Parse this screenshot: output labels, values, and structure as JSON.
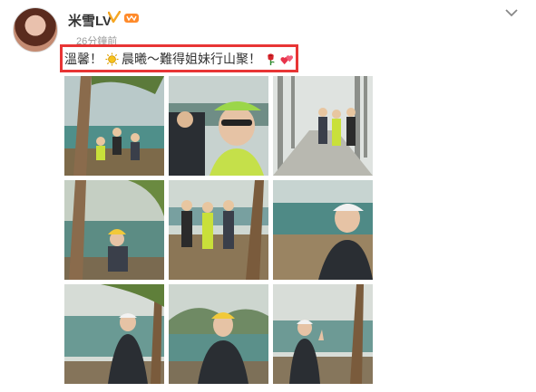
{
  "post": {
    "username": "米雪LV",
    "timestamp": "26分鐘前",
    "caption_parts": [
      "溫馨！",
      "晨曦～難得姐妹行山聚！"
    ]
  },
  "icons": {
    "verified": "verified-v-badge-icon",
    "vip": "vip-crown-icon",
    "menu": "chevron-down-icon",
    "sun": "sun-emoji-icon",
    "flower": "rose-emoji-icon",
    "hearts": "two-hearts-emoji-icon"
  },
  "colors": {
    "highlight_border": "#e83535",
    "verified": "#f5a623",
    "username": "#333333",
    "timestamp": "#999999"
  },
  "photos": [
    {
      "id": "photo-1",
      "scene": "tree-lake-group"
    },
    {
      "id": "photo-2",
      "scene": "selfie-green-cap"
    },
    {
      "id": "photo-3",
      "scene": "forest-path-group"
    },
    {
      "id": "photo-4",
      "scene": "yellow-cap-lake"
    },
    {
      "id": "photo-5",
      "scene": "trio-roots"
    },
    {
      "id": "photo-6",
      "scene": "white-cap-lake"
    },
    {
      "id": "photo-7",
      "scene": "white-cap-tree"
    },
    {
      "id": "photo-8",
      "scene": "yellow-cap-reservoir"
    },
    {
      "id": "photo-9",
      "scene": "peace-sign-lake"
    }
  ]
}
